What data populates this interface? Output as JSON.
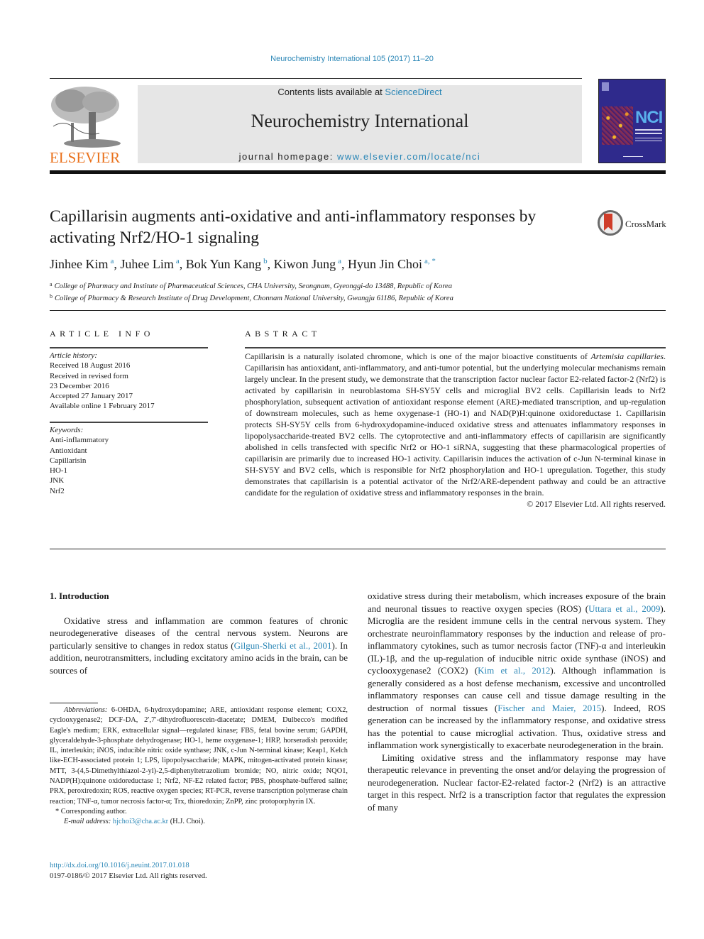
{
  "header": {
    "journal_ref": "Neurochemistry International 105 (2017) 11–20",
    "contents_prefix": "Contents lists available at ",
    "contents_link": "ScienceDirect",
    "journal_name": "Neurochemistry International",
    "homepage_prefix": "journal homepage: ",
    "homepage_link": "www.elsevier.com/locate/nci",
    "publisher_logo_text": "ELSEVIER",
    "cover_abbrev": "NCI",
    "brand_color": "#e9711c",
    "link_color": "#2a86b6"
  },
  "article": {
    "title": "Capillarisin augments anti-oxidative and anti-inflammatory responses by activating Nrf2/HO-1 signaling",
    "crossmark_label": "CrossMark",
    "authors": [
      {
        "name": "Jinhee Kim",
        "sup": "a"
      },
      {
        "name": "Juhee Lim",
        "sup": "a"
      },
      {
        "name": "Bok Yun Kang",
        "sup": "b"
      },
      {
        "name": "Kiwon Jung",
        "sup": "a"
      },
      {
        "name": "Hyun Jin Choi",
        "sup": "a, *"
      }
    ],
    "affiliations": [
      {
        "sup": "a",
        "text": "College of Pharmacy and Institute of Pharmaceutical Sciences, CHA University, Seongnam, Gyeonggi-do 13488, Republic of Korea"
      },
      {
        "sup": "b",
        "text": "College of Pharmacy & Research Institute of Drug Development, Chonnam National University, Gwangju 61186, Republic of Korea"
      }
    ]
  },
  "article_info": {
    "heading": "ARTICLE INFO",
    "history_label": "Article history:",
    "history": [
      "Received 18 August 2016",
      "Received in revised form",
      "23 December 2016",
      "Accepted 27 January 2017",
      "Available online 1 February 2017"
    ],
    "keywords_label": "Keywords:",
    "keywords": [
      "Anti-inflammatory",
      "Antioxidant",
      "Capillarisin",
      "HO-1",
      "JNK",
      "Nrf2"
    ]
  },
  "abstract": {
    "heading": "ABSTRACT",
    "text_1": "Capillarisin is a naturally isolated chromone, which is one of the major bioactive constituents of ",
    "species": "Artemisia capillaries",
    "text_2": ". Capillarisin has antioxidant, anti-inflammatory, and anti-tumor potential, but the underlying molecular mechanisms remain largely unclear. In the present study, we demonstrate that the transcription factor nuclear factor E2-related factor-2 (Nrf2) is activated by capillarisin in neuroblastoma SH-SY5Y cells and microglial BV2 cells. Capillarisin leads to Nrf2 phosphorylation, subsequent activation of antioxidant response element (ARE)-mediated transcription, and up-regulation of downstream molecules, such as heme oxygenase-1 (HO-1) and NAD(P)H:quinone oxidoreductase 1. Capillarisin protects SH-SY5Y cells from 6-hydroxydopamine-induced oxidative stress and attenuates inflammatory responses in lipopolysaccharide-treated BV2 cells. The cytoprotective and anti-inflammatory effects of capillarisin are significantly abolished in cells transfected with specific Nrf2 or HO-1 siRNA, suggesting that these pharmacological properties of capillarisin are primarily due to increased HO-1 activity. Capillarisin induces the activation of c-Jun N-terminal kinase in SH-SY5Y and BV2 cells, which is responsible for Nrf2 phosphorylation and HO-1 upregulation. Together, this study demonstrates that capillarisin is a potential activator of the Nrf2/ARE-dependent pathway and could be an attractive candidate for the regulation of oxidative stress and inflammatory responses in the brain.",
    "copyright": "© 2017 Elsevier Ltd. All rights reserved."
  },
  "body": {
    "section_heading": "1.  Introduction",
    "left_p1_a": "Oxidative stress and inflammation are common features of chronic neurodegenerative diseases of the central nervous system. Neurons are particularly sensitive to changes in redox status (",
    "left_cite_1": "Gilgun-Sherki et al., 2001",
    "left_p1_b": "). In addition, neurotransmitters, including excitatory amino acids in the brain, can be sources of",
    "right_p1_a": "oxidative stress during their metabolism, which increases exposure of the brain and neuronal tissues to reactive oxygen species (ROS) (",
    "right_cite_1": "Uttara et al., 2009",
    "right_p1_b": "). Microglia are the resident immune cells in the central nervous system. They orchestrate neuroinflammatory responses by the induction and release of pro-inflammatory cytokines, such as tumor necrosis factor (TNF)-α and interleukin (IL)-1β, and the up-regulation of inducible nitric oxide synthase (iNOS) and cyclooxygenase2 (COX2) (",
    "right_cite_2": "Kim et al., 2012",
    "right_p1_c": "). Although inflammation is generally considered as a host defense mechanism, excessive and uncontrolled inflammatory responses can cause cell and tissue damage resulting in the destruction of normal tissues (",
    "right_cite_3": "Fischer and Maier, 2015",
    "right_p1_d": "). Indeed, ROS generation can be increased by the inflammatory response, and oxidative stress has the potential to cause microglial activation. Thus, oxidative stress and inflammation work synergistically to exacerbate neurodegeneration in the brain.",
    "right_p2": "Limiting oxidative stress and the inflammatory response may have therapeutic relevance in preventing the onset and/or delaying the progression of neurodegeneration. Nuclear factor-E2-related factor-2 (Nrf2) is an attractive target in this respect. Nrf2 is a transcription factor that regulates the expression of many"
  },
  "footnotes": {
    "abbrev_label": "Abbreviations:",
    "abbrev_text": " 6-OHDA, 6-hydroxydopamine; ARE, antioxidant response element; COX2, cyclooxygenase2; DCF-DA, 2′,7′-dihydrofluorescein-diacetate; DMEM, Dulbecco's modified Eagle's medium; ERK, extracellular signal—regulated kinase; FBS, fetal bovine serum; GAPDH, glyceraldehyde-3-phosphate dehydrogenase; HO-1, heme oxygenase-1; HRP, horseradish peroxide; IL, interleukin; iNOS, inducible nitric oxide synthase; JNK, c-Jun N-terminal kinase; Keap1, Kelch like-ECH-associated protein 1; LPS, lipopolysaccharide; MAPK, mitogen-activated protein kinase; MTT, 3-(4,5-Dimethylthiazol-2-yl)-2,5-diphenyltetrazolium bromide; NO, nitric oxide; NQO1, NADP(H):quinone oxidoreductase 1; Nrf2, NF-E2 related factor; PBS, phosphate-buffered saline; PRX, peroxiredoxin; ROS, reactive oxygen species; RT-PCR, reverse transcription polymerase chain reaction; TNF-α, tumor necrosis factor-α; Trx, thioredoxin; ZnPP, zinc protoporphyrin IX.",
    "corresponding": "* Corresponding author.",
    "email_label": "E-mail address:",
    "email": "hjchoi3@cha.ac.kr",
    "email_suffix": " (H.J. Choi).",
    "doi": "http://dx.doi.org/10.1016/j.neuint.2017.01.018",
    "issn_copyright": "0197-0186/© 2017 Elsevier Ltd. All rights reserved."
  }
}
